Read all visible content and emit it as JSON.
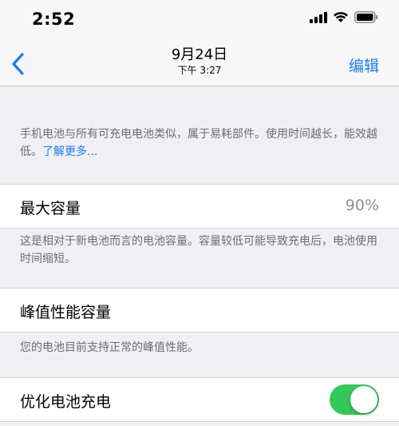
{
  "status_bar": {
    "time": "2:52",
    "icons": [
      "signal-icon",
      "wifi-icon",
      "battery-icon"
    ]
  },
  "nav": {
    "back_icon": "chevron-left-icon",
    "date": "9月24日",
    "time": "下午 3:27",
    "edit_label": "编辑"
  },
  "intro": {
    "text": "手机电池与所有可充电电池类似，属于易耗部件。使用时间越长，能效越低。",
    "link": "了解更多..."
  },
  "max_capacity": {
    "label": "最大容量",
    "value": "90%",
    "footnote": "这是相对于新电池而言的电池容量。容量较低可能导致充电后，电池使用时间缩短。"
  },
  "peak_performance": {
    "label": "峰值性能容量",
    "footnote": "您的电池目前支持正常的峰值性能。"
  },
  "optimized_charging": {
    "label": "优化电池充电",
    "toggle_on": true
  },
  "colors": {
    "accent": "#1a7cf2",
    "toggle_on": "#34c759",
    "background": "#efeff4"
  }
}
